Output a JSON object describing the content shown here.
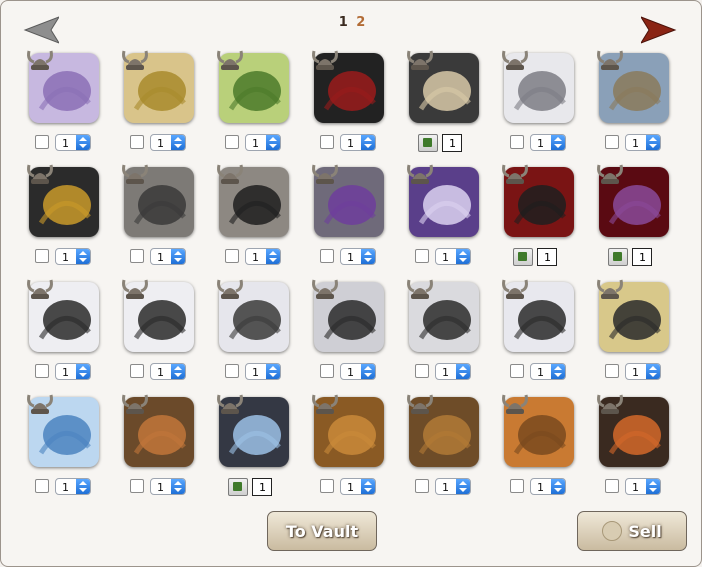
{
  "pager": {
    "current": "1",
    "other": "2"
  },
  "nav": {
    "prev_icon": "left-arrow-icon",
    "next_icon": "right-arrow-icon"
  },
  "default_qty": "1",
  "rows": [
    [
      {
        "name": "lilac-ribbon-item",
        "bg": "#c7b8e0",
        "fg": "#8b6fb5",
        "type": "spinner"
      },
      {
        "name": "gold-band-item",
        "bg": "#d9c48a",
        "fg": "#a88b2c",
        "type": "spinner"
      },
      {
        "name": "green-jewel-bracelet-item",
        "bg": "#b9d07a",
        "fg": "#4b7a2a",
        "type": "spinner"
      },
      {
        "name": "shadow-dragon-item",
        "bg": "#222222",
        "fg": "#9a1b1b",
        "type": "spinner"
      },
      {
        "name": "black-dragon-lightning-item",
        "bg": "#3a3a3a",
        "fg": "#d8c9a8",
        "type": "group",
        "qty": "1"
      },
      {
        "name": "white-hood-item",
        "bg": "#e8e8ec",
        "fg": "#7d7d85",
        "type": "spinner"
      },
      {
        "name": "viking-helmet-item",
        "bg": "#8aa0b8",
        "fg": "#8a7a5a",
        "type": "spinner"
      }
    ],
    [
      {
        "name": "gold-collar-item",
        "bg": "#2b2b2b",
        "fg": "#c99a2a",
        "type": "spinner"
      },
      {
        "name": "grey-bird-skull-item",
        "bg": "#7d7a76",
        "fg": "#3a3a3a",
        "type": "spinner"
      },
      {
        "name": "black-raven-item",
        "bg": "#8d8882",
        "fg": "#1f1f1f",
        "type": "spinner"
      },
      {
        "name": "purple-spider-item",
        "bg": "#6f6a7a",
        "fg": "#6e3d9c",
        "type": "spinner"
      },
      {
        "name": "purple-skull-item",
        "bg": "#5a3f8a",
        "fg": "#dcd2f0",
        "type": "spinner"
      },
      {
        "name": "red-cape-claw-item",
        "bg": "#7a1414",
        "fg": "#1e1e1e",
        "type": "group",
        "qty": "1"
      },
      {
        "name": "crimson-claw-item",
        "bg": "#5a0a12",
        "fg": "#8a4a9a",
        "type": "group",
        "qty": "1"
      }
    ],
    [
      {
        "name": "white-claw-wrap-item",
        "bg": "#eeeef2",
        "fg": "#2a2a2a",
        "type": "spinner"
      },
      {
        "name": "white-claw-wrap-2-item",
        "bg": "#eeeef2",
        "fg": "#2a2a2a",
        "type": "spinner"
      },
      {
        "name": "silver-wrap-item",
        "bg": "#e6e6ec",
        "fg": "#3a3a3a",
        "type": "spinner"
      },
      {
        "name": "white-scarf-item",
        "bg": "#cfcfd5",
        "fg": "#2a2a2a",
        "type": "spinner"
      },
      {
        "name": "white-coat-item",
        "bg": "#dadade",
        "fg": "#2b2b2b",
        "type": "spinner"
      },
      {
        "name": "white-mask-item",
        "bg": "#e8e8ee",
        "fg": "#2a2a2a",
        "type": "spinner"
      },
      {
        "name": "spectacles-item",
        "bg": "#d8c88a",
        "fg": "#2a2a2a",
        "type": "spinner"
      }
    ],
    [
      {
        "name": "snowflake-item",
        "bg": "#bcd7f0",
        "fg": "#4b84bf",
        "type": "spinner"
      },
      {
        "name": "bronze-armor-item",
        "bg": "#6b4a2a",
        "fg": "#c1763a",
        "type": "spinner"
      },
      {
        "name": "blue-emblem-item",
        "bg": "#343844",
        "fg": "#9cc1e6",
        "type": "group",
        "qty": "1"
      },
      {
        "name": "bronze-gauntlet-item",
        "bg": "#8a5a24",
        "fg": "#c98a3a",
        "type": "spinner"
      },
      {
        "name": "bronze-plate-item",
        "bg": "#6e4c28",
        "fg": "#b27a36",
        "type": "spinner"
      },
      {
        "name": "orange-wrap-item",
        "bg": "#c97a32",
        "fg": "#7a4a1e",
        "type": "spinner"
      },
      {
        "name": "dark-claw-item",
        "bg": "#3a2a20",
        "fg": "#d3682a",
        "type": "spinner"
      }
    ]
  ],
  "buttons": {
    "vault_label": "To Vault",
    "sell_label": "Sell"
  },
  "colors": {
    "arrow_prev": "#8a8a8a",
    "arrow_next": "#8a2a1a",
    "page_other": "#b26b35"
  }
}
